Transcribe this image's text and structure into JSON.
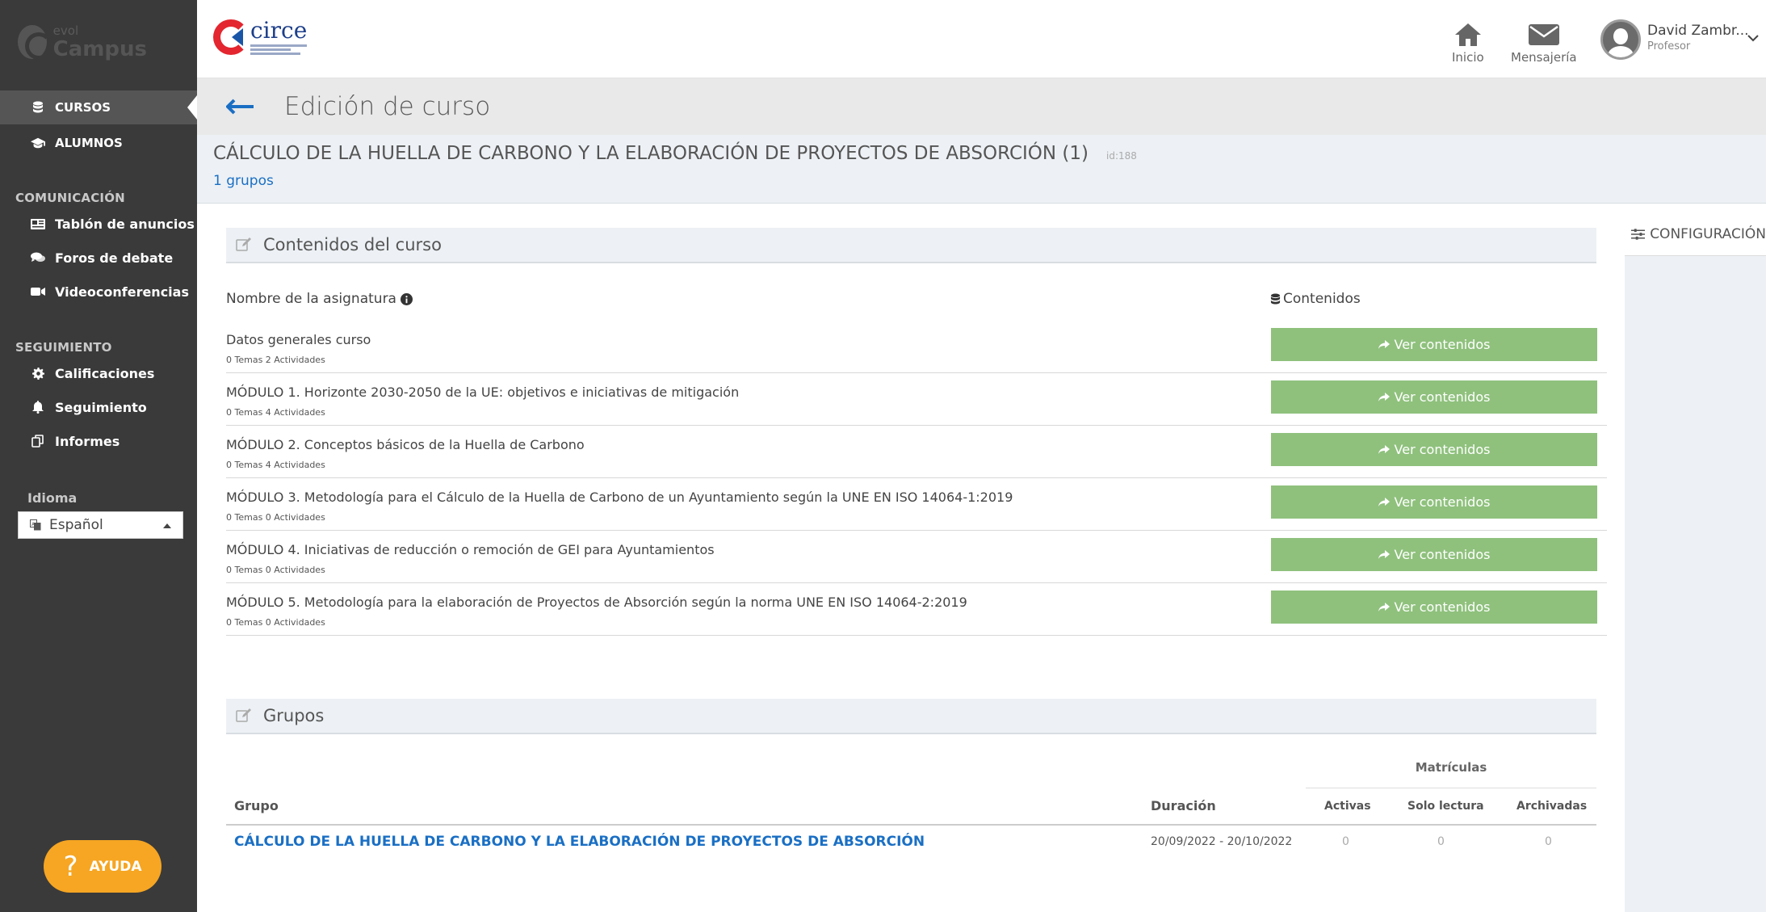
{
  "sidebar": {
    "logo": {
      "small": "evol",
      "big": "Campus"
    },
    "nav_main": [
      {
        "label": "CURSOS",
        "icon": "database-icon"
      },
      {
        "label": "ALUMNOS",
        "icon": "graduation-cap-icon"
      }
    ],
    "sections": [
      {
        "title": "COMUNICACIÓN",
        "items": [
          {
            "label": "Tablón de anuncios",
            "icon": "newspaper-icon"
          },
          {
            "label": "Foros de debate",
            "icon": "comments-icon"
          },
          {
            "label": "Videoconferencias",
            "icon": "video-camera-icon"
          }
        ]
      },
      {
        "title": "SEGUIMIENTO",
        "items": [
          {
            "label": "Calificaciones",
            "icon": "gear-icon"
          },
          {
            "label": "Seguimiento",
            "icon": "bell-icon"
          },
          {
            "label": "Informes",
            "icon": "copy-icon"
          }
        ]
      }
    ],
    "language": {
      "label": "Idioma",
      "selected": "Español"
    },
    "help": {
      "label": "AYUDA",
      "glyph": "?"
    }
  },
  "header": {
    "brand": {
      "name": "circe"
    },
    "home_label": "Inicio",
    "messages_label": "Mensajería",
    "user": {
      "name": "David Zambr...",
      "role": "Profesor"
    }
  },
  "page": {
    "title": "Edición de curso",
    "course_title": "CÁLCULO DE LA HUELLA DE CARBONO Y LA ELABORACIÓN DE PROYECTOS DE ABSORCIÓN  (1)",
    "course_id": "id:188",
    "groups_link": "1 grupos",
    "config_label": "CONFIGURACIÓN"
  },
  "contents": {
    "section_title": "Contenidos del curso",
    "col_name": "Nombre de la asignatura",
    "col_contents": "Contenidos",
    "button_label": "Ver contenidos",
    "rows": [
      {
        "name": "Datos generales curso",
        "meta": "0 Temas 2 Actividades"
      },
      {
        "name": "MÓDULO 1. Horizonte 2030-2050 de la UE: objetivos e iniciativas de mitigación",
        "meta": "0 Temas 4 Actividades"
      },
      {
        "name": "MÓDULO 2. Conceptos básicos de la Huella de Carbono",
        "meta": "0 Temas 4 Actividades"
      },
      {
        "name": "MÓDULO 3. Metodología para el Cálculo de la Huella de Carbono de un Ayuntamiento según la UNE EN ISO 14064-1:2019",
        "meta": "0 Temas 0 Actividades"
      },
      {
        "name": "MÓDULO 4. Iniciativas de reducción o remoción de GEI para Ayuntamientos",
        "meta": "0 Temas 0 Actividades"
      },
      {
        "name": "MÓDULO 5. Metodología para la elaboración de Proyectos de Absorción según la norma UNE EN ISO 14064-2:2019",
        "meta": "0 Temas 0 Actividades"
      }
    ]
  },
  "groups": {
    "section_title": "Grupos",
    "matriculas": "Matrículas",
    "col_group": "Grupo",
    "col_duration": "Duración",
    "col_active": "Activas",
    "col_readonly": "Solo lectura",
    "col_archived": "Archivadas",
    "row": {
      "name": "CÁLCULO DE LA HUELLA DE CARBONO Y LA ELABORACIÓN DE PROYECTOS DE ABSORCIÓN",
      "dates": "20/09/2022 - 20/10/2022",
      "active": "0",
      "readonly": "0",
      "archived": "0"
    }
  },
  "colors": {
    "sidebar_bg": "#3a3a3a",
    "button_green": "#8fc17d",
    "link_blue": "#1a6fc4",
    "help_orange": "#f6a623"
  }
}
